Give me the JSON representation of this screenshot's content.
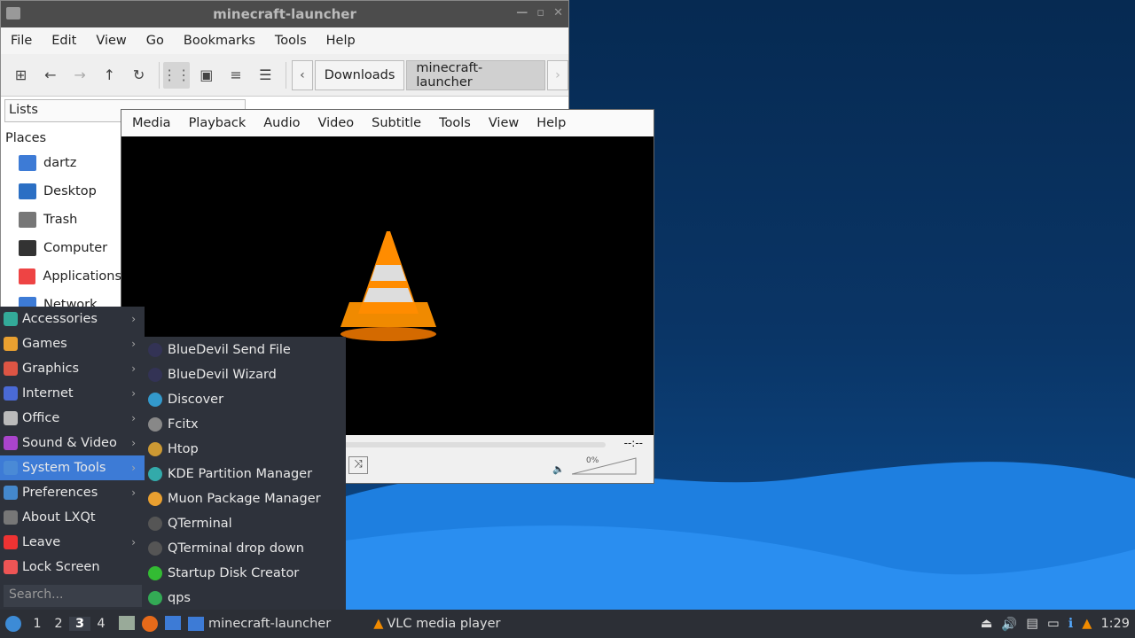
{
  "file_manager": {
    "title": "minecraft-launcher",
    "menu": [
      "File",
      "Edit",
      "View",
      "Go",
      "Bookmarks",
      "Tools",
      "Help"
    ],
    "crumbs": [
      "Downloads",
      "minecraft-launcher"
    ],
    "side_title": "Lists",
    "places_header": "Places",
    "places": [
      {
        "label": "dartz",
        "color": "#3d7bd6"
      },
      {
        "label": "Desktop",
        "color": "#2b6fc4"
      },
      {
        "label": "Trash",
        "color": "#777"
      },
      {
        "label": "Computer",
        "color": "#333"
      },
      {
        "label": "Applications",
        "color": "#e44"
      },
      {
        "label": "Network",
        "color": "#3d7bd6"
      }
    ]
  },
  "vlc": {
    "menu": [
      "Media",
      "Playback",
      "Audio",
      "Video",
      "Subtitle",
      "Tools",
      "View",
      "Help"
    ],
    "time": "--:--",
    "volume": "0%"
  },
  "start_menu": {
    "items": [
      {
        "label": "Accessories",
        "sub": true,
        "color": "#3a9"
      },
      {
        "label": "Games",
        "sub": true,
        "color": "#e9a030"
      },
      {
        "label": "Graphics",
        "sub": true,
        "color": "#d54"
      },
      {
        "label": "Internet",
        "sub": true,
        "color": "#4a6ad6"
      },
      {
        "label": "Office",
        "sub": true,
        "color": "#bbb"
      },
      {
        "label": "Sound & Video",
        "sub": true,
        "color": "#a4c"
      },
      {
        "label": "System Tools",
        "sub": true,
        "color": "#4a8ad6"
      },
      {
        "label": "Preferences",
        "sub": true,
        "color": "#48c"
      },
      {
        "label": "About LXQt",
        "sub": false,
        "color": "#777"
      },
      {
        "label": "Leave",
        "sub": true,
        "color": "#e33"
      },
      {
        "label": "Lock Screen",
        "sub": false,
        "color": "#e55"
      }
    ],
    "search_placeholder": "Search...",
    "submenu": [
      {
        "label": "BlueDevil Send File",
        "color": "#335"
      },
      {
        "label": "BlueDevil Wizard",
        "color": "#335"
      },
      {
        "label": "Discover",
        "color": "#39c"
      },
      {
        "label": "Fcitx",
        "color": "#888"
      },
      {
        "label": "Htop",
        "color": "#c93"
      },
      {
        "label": "KDE Partition Manager",
        "color": "#3aa"
      },
      {
        "label": "Muon Package Manager",
        "color": "#e9a030"
      },
      {
        "label": "QTerminal",
        "color": "#555"
      },
      {
        "label": "QTerminal drop down",
        "color": "#555"
      },
      {
        "label": "Startup Disk Creator",
        "color": "#3b3"
      },
      {
        "label": "qps",
        "color": "#3a5"
      }
    ]
  },
  "taskbar": {
    "workspaces": [
      "1",
      "2",
      "3",
      "4"
    ],
    "active_ws": "3",
    "windows": [
      "minecraft-launcher",
      "VLC media player"
    ],
    "clock": "1:29"
  }
}
